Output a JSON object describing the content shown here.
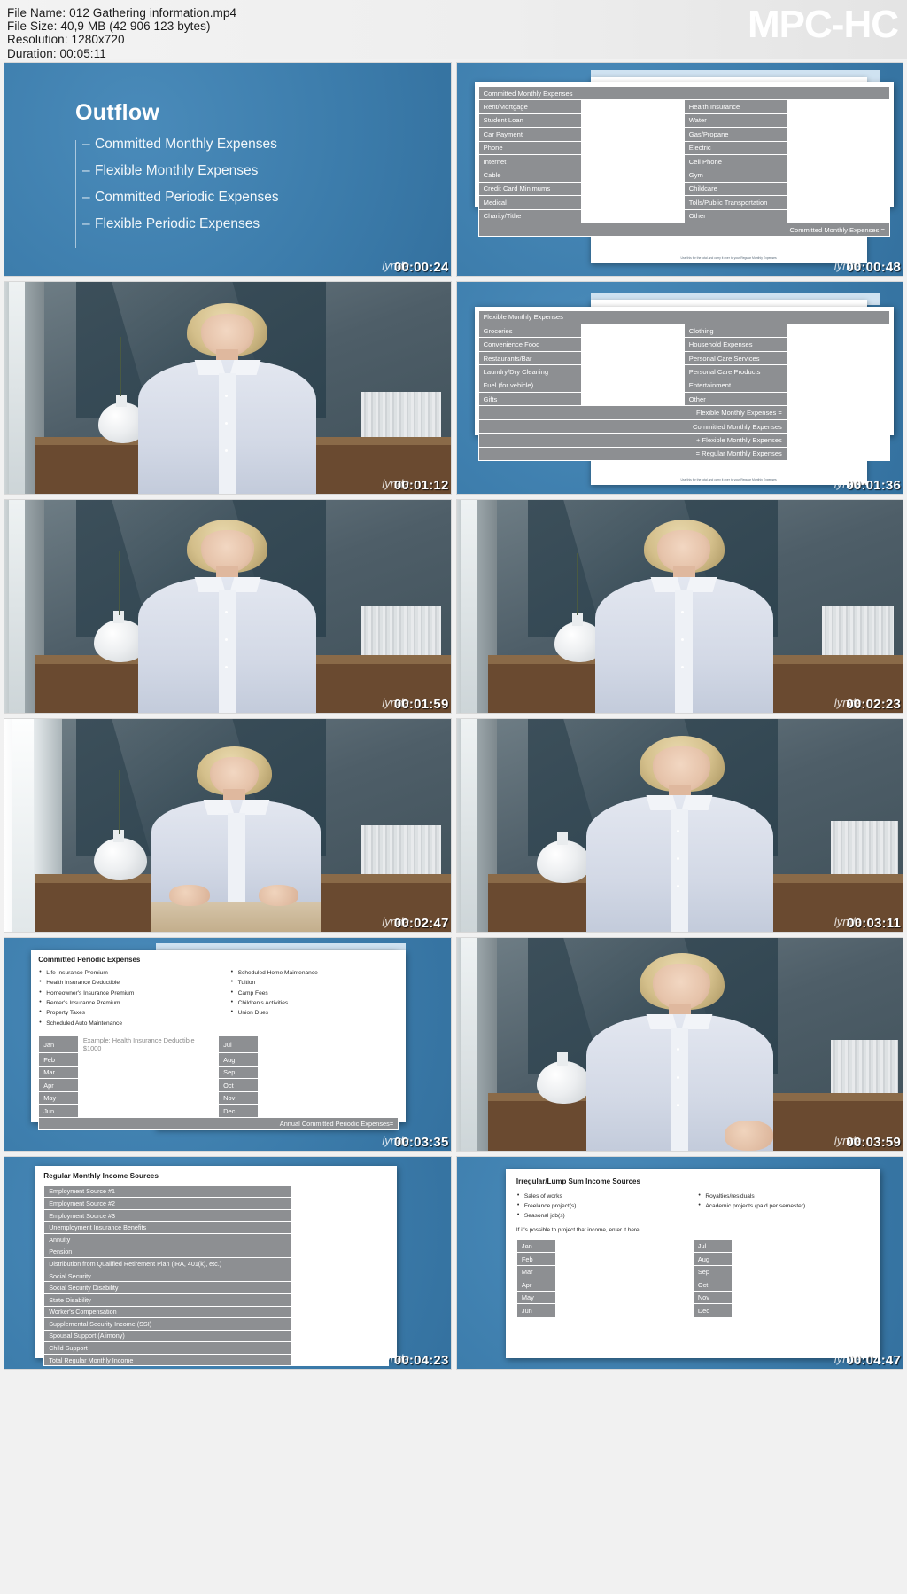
{
  "header": {
    "file_name_label": "File Name: 012 Gathering information.mp4",
    "file_size_label": "File Size: 40,9 MB (42 906 123 bytes)",
    "resolution_label": "Resolution: 1280x720",
    "duration_label": "Duration: 00:05:11",
    "brand": "MPC-HC"
  },
  "watermark": "lynda",
  "colors": {
    "slide_blue": "#3c7cab",
    "table_gray": "#8d8f92",
    "paper_white": "#ffffff",
    "accent_lightblue": "#cfe2f1"
  },
  "thumbnails": [
    {
      "index": 1,
      "timestamp": "00:00:24",
      "kind": "slide-outflow"
    },
    {
      "index": 2,
      "timestamp": "00:00:48",
      "kind": "slide-committed-monthly"
    },
    {
      "index": 3,
      "timestamp": "00:01:12",
      "kind": "video"
    },
    {
      "index": 4,
      "timestamp": "00:01:36",
      "kind": "slide-flexible-monthly"
    },
    {
      "index": 5,
      "timestamp": "00:01:59",
      "kind": "video"
    },
    {
      "index": 6,
      "timestamp": "00:02:23",
      "kind": "video"
    },
    {
      "index": 7,
      "timestamp": "00:02:47",
      "kind": "video"
    },
    {
      "index": 8,
      "timestamp": "00:03:11",
      "kind": "video"
    },
    {
      "index": 9,
      "timestamp": "00:03:35",
      "kind": "slide-committed-periodic"
    },
    {
      "index": 10,
      "timestamp": "00:03:59",
      "kind": "video"
    },
    {
      "index": 11,
      "timestamp": "00:04:23",
      "kind": "slide-regular-income"
    },
    {
      "index": 12,
      "timestamp": "00:04:47",
      "kind": "slide-irregular-income"
    }
  ],
  "slide_outflow": {
    "title": "Outflow",
    "items": [
      "Committed Monthly Expenses",
      "Flexible Monthly Expenses",
      "Committed Periodic Expenses",
      "Flexible Periodic Expenses"
    ]
  },
  "slide_committed_monthly": {
    "title": "Committed Monthly Expenses",
    "left_rows": [
      "Rent/Mortgage",
      "Student Loan",
      "Car Payment",
      "Phone",
      "Internet",
      "Cable",
      "Credit Card Minimums",
      "Medical",
      "Charity/Tithe"
    ],
    "right_rows": [
      "Health Insurance",
      "Water",
      "Gas/Propane",
      "Electric",
      "Cell Phone",
      "Gym",
      "Childcare",
      "Tolls/Public Transportation",
      "Other"
    ],
    "total_row": "Committed Monthly Expenses =",
    "footnote": "Use this for the total and carry it over to your Regular Monthly Expenses"
  },
  "slide_flexible_monthly": {
    "title": "Flexible Monthly Expenses",
    "left_rows": [
      "Groceries",
      "Convenience Food",
      "Restaurants/Bar",
      "Laundry/Dry Cleaning",
      "Fuel (for vehicle)",
      "Gifts"
    ],
    "right_rows": [
      "Clothing",
      "Household Expenses",
      "Personal Care Services",
      "Personal Care Products",
      "Entertainment",
      "Other"
    ],
    "total_rows": [
      "Flexible Monthly Expenses =",
      "Committed Monthly Expenses",
      "+ Flexible Monthly Expenses",
      "= Regular Monthly Expenses"
    ],
    "footnote": "Use this for the total and carry it over to your Regular Monthly Expenses"
  },
  "slide_committed_periodic": {
    "title": "Committed Periodic Expenses",
    "bullets_left": [
      "Life Insurance Premium",
      "Health Insurance Deductible",
      "Homeowner's Insurance Premium",
      "Renter's Insurance Premium",
      "Property Taxes",
      "Scheduled Auto Maintenance"
    ],
    "bullets_right": [
      "Scheduled Home Maintenance",
      "Tuition",
      "Camp Fees",
      "Children's Activities",
      "Union Dues"
    ],
    "months_left": [
      "Jan",
      "Feb",
      "Mar",
      "Apr",
      "May",
      "Jun"
    ],
    "months_right": [
      "Jul",
      "Aug",
      "Sep",
      "Oct",
      "Nov",
      "Dec"
    ],
    "example_value": "Example: Health Insurance Deductible $1000",
    "total_row": "Annual Committed Periodic Expenses="
  },
  "slide_regular_income": {
    "title": "Regular Monthly Income Sources",
    "rows": [
      "Employment Source #1",
      "Employment Source #2",
      "Employment Source #3",
      "Unemployment Insurance Benefits",
      "Annuity",
      "Pension",
      "Distribution from Qualified Retirement Plan (IRA, 401(k), etc.)",
      "Social Security",
      "Social Security Disability",
      "State Disability",
      "Worker's Compensation",
      "Supplemental Security Income (SSI)",
      "Spousal Support (Alimony)",
      "Child Support",
      "Total Regular Monthly Income"
    ]
  },
  "slide_irregular_income": {
    "title": "Irregular/Lump Sum Income Sources",
    "bullets_left": [
      "Sales of works",
      "Freelance project(s)",
      "Seasonal job(s)"
    ],
    "bullets_right": [
      "Royalties/residuals",
      "Academic projects (paid per semester)"
    ],
    "note": "If it's possible to project that income, enter it here:",
    "months_left": [
      "Jan",
      "Feb",
      "Mar",
      "Apr",
      "May",
      "Jun"
    ],
    "months_right": [
      "Jul",
      "Aug",
      "Sep",
      "Oct",
      "Nov",
      "Dec"
    ]
  }
}
